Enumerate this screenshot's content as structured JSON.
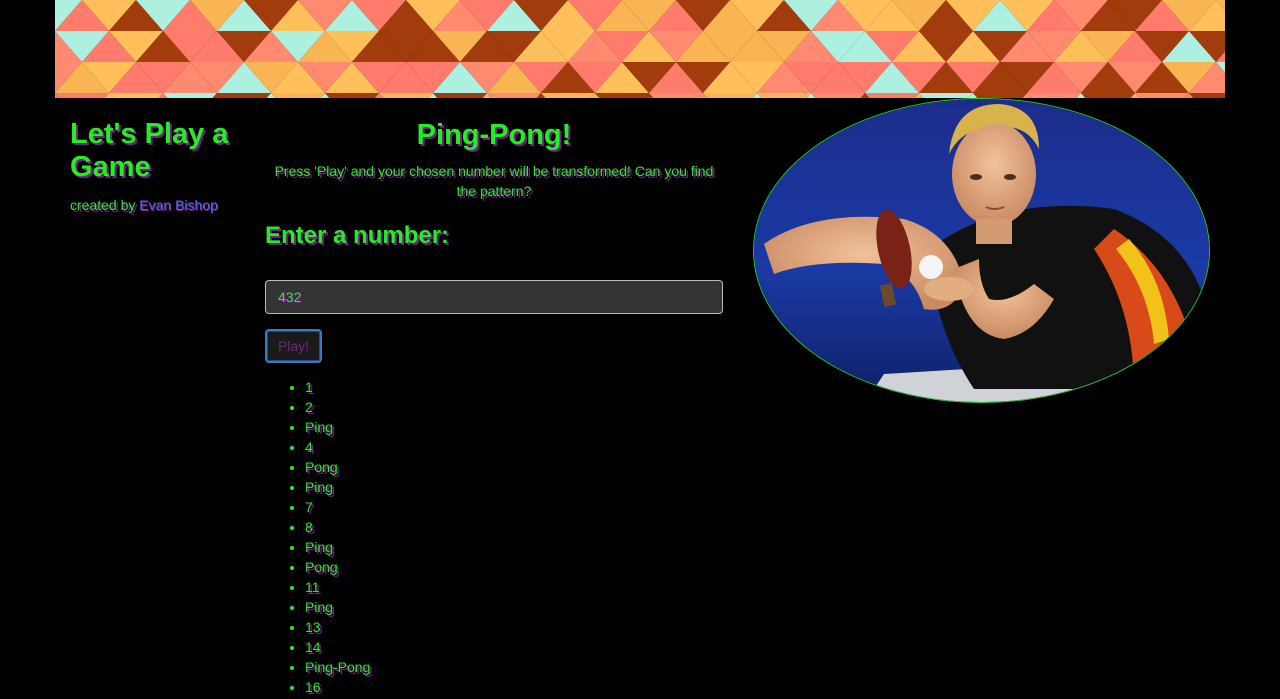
{
  "header": {
    "title": "Let's Play a Game",
    "byline_prefix": "created by",
    "author_link": "Evan Bishop"
  },
  "game": {
    "title": "Ping-Pong!",
    "instructions": "Press 'Play' and your chosen number will be transformed! Can you find the pattern?",
    "prompt": "Enter a number:",
    "input_value": "432",
    "play_label": "Play!"
  },
  "results": [
    "1",
    "2",
    "Ping",
    "4",
    "Pong",
    "Ping",
    "7",
    "8",
    "Ping",
    "Pong",
    "11",
    "Ping",
    "13",
    "14",
    "Ping-Pong",
    "16"
  ],
  "colors": {
    "text": "#22ee22",
    "shadow": "#7a1a8c",
    "link": "#4a6fe0",
    "background": "#000000"
  },
  "images": {
    "banner": "triangle-pattern-banner",
    "photo": "ping-pong-player-photo"
  }
}
